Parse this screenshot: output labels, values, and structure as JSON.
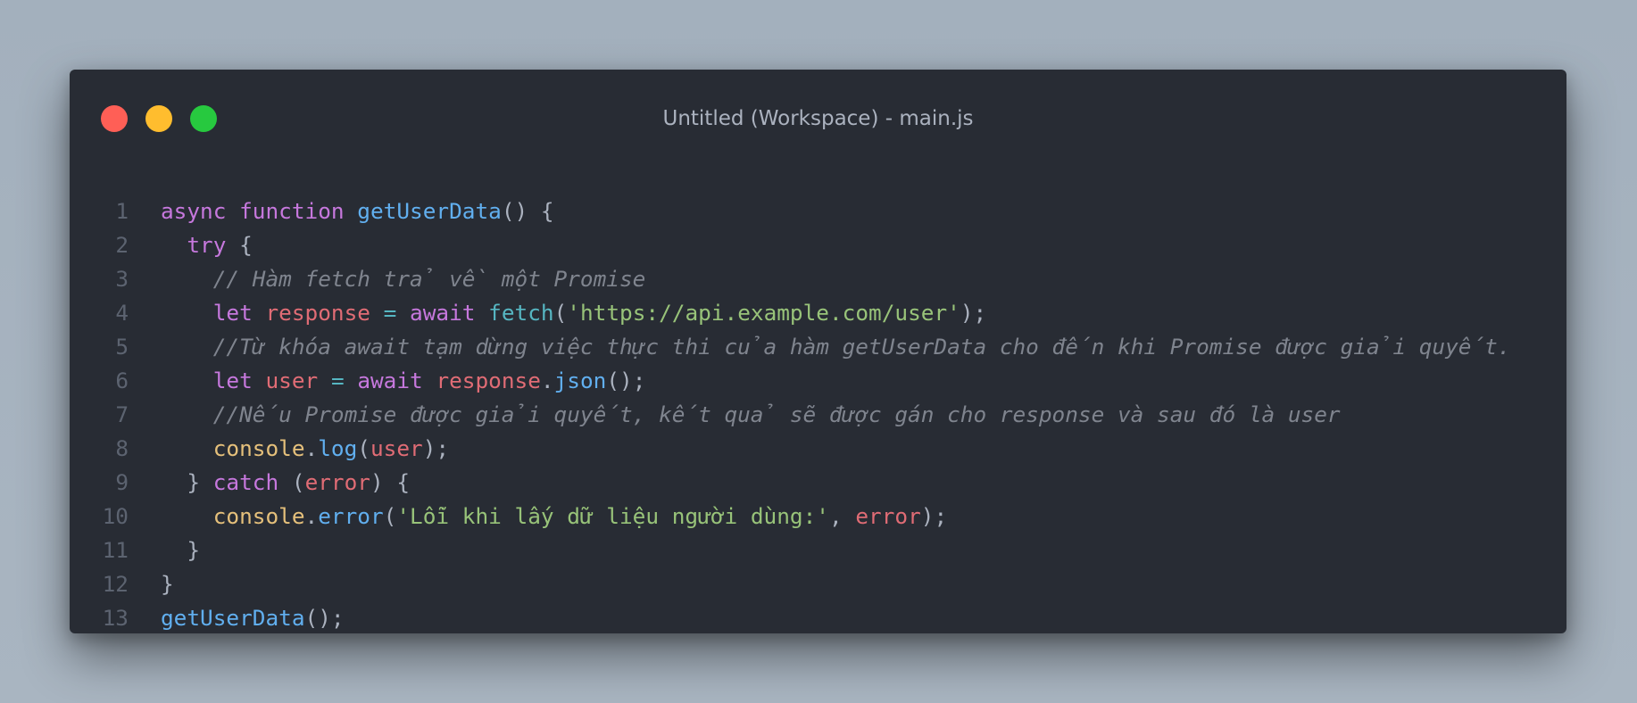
{
  "window": {
    "title": "Untitled (Workspace) - main.js",
    "controls": {
      "close_color": "#ff5f56",
      "minimize_color": "#ffbd2e",
      "maximize_color": "#27c93f"
    }
  },
  "theme": {
    "background": "#282c34",
    "keyword": "#c678dd",
    "function": "#61afef",
    "variable": "#e06c75",
    "string": "#98c379",
    "comment": "#7f848e",
    "object": "#e5c07b"
  },
  "editor": {
    "language": "javascript",
    "line_numbers": [
      "1",
      "2",
      "3",
      "4",
      "5",
      "6",
      "7",
      "8",
      "9",
      "10",
      "11",
      "12",
      "13"
    ],
    "lines": [
      {
        "indent": "",
        "tokens": [
          {
            "t": "kw",
            "v": "async"
          },
          {
            "t": "pn",
            "v": " "
          },
          {
            "t": "kw",
            "v": "function"
          },
          {
            "t": "pn",
            "v": " "
          },
          {
            "t": "fn",
            "v": "getUserData"
          },
          {
            "t": "pn",
            "v": "() {"
          }
        ]
      },
      {
        "indent": "  ",
        "tokens": [
          {
            "t": "kw",
            "v": "try"
          },
          {
            "t": "pn",
            "v": " {"
          }
        ]
      },
      {
        "indent": "    ",
        "tokens": [
          {
            "t": "cm",
            "v": "// Hàm fetch trả về một Promise"
          }
        ]
      },
      {
        "indent": "    ",
        "tokens": [
          {
            "t": "kw",
            "v": "let"
          },
          {
            "t": "pn",
            "v": " "
          },
          {
            "t": "var",
            "v": "response"
          },
          {
            "t": "pn",
            "v": " "
          },
          {
            "t": "op",
            "v": "="
          },
          {
            "t": "pn",
            "v": " "
          },
          {
            "t": "kw",
            "v": "await"
          },
          {
            "t": "pn",
            "v": " "
          },
          {
            "t": "op",
            "v": "fetch"
          },
          {
            "t": "pn",
            "v": "("
          },
          {
            "t": "str",
            "v": "'https://api.example.com/user'"
          },
          {
            "t": "pn",
            "v": ");"
          }
        ]
      },
      {
        "indent": "    ",
        "tokens": [
          {
            "t": "cm",
            "v": "//Từ khóa await tạm dừng việc thực thi của hàm getUserData cho đến khi Promise được giải quyết."
          }
        ]
      },
      {
        "indent": "    ",
        "tokens": [
          {
            "t": "kw",
            "v": "let"
          },
          {
            "t": "pn",
            "v": " "
          },
          {
            "t": "var",
            "v": "user"
          },
          {
            "t": "pn",
            "v": " "
          },
          {
            "t": "op",
            "v": "="
          },
          {
            "t": "pn",
            "v": " "
          },
          {
            "t": "kw",
            "v": "await"
          },
          {
            "t": "pn",
            "v": " "
          },
          {
            "t": "var",
            "v": "response"
          },
          {
            "t": "pn",
            "v": "."
          },
          {
            "t": "fn",
            "v": "json"
          },
          {
            "t": "pn",
            "v": "();"
          }
        ]
      },
      {
        "indent": "    ",
        "tokens": [
          {
            "t": "cm",
            "v": "//Nếu Promise được giải quyết, kết quả sẽ được gán cho response và sau đó là user"
          }
        ]
      },
      {
        "indent": "    ",
        "tokens": [
          {
            "t": "obj",
            "v": "console"
          },
          {
            "t": "pn",
            "v": "."
          },
          {
            "t": "fn",
            "v": "log"
          },
          {
            "t": "pn",
            "v": "("
          },
          {
            "t": "var",
            "v": "user"
          },
          {
            "t": "pn",
            "v": ");"
          }
        ]
      },
      {
        "indent": "  ",
        "tokens": [
          {
            "t": "pn",
            "v": "} "
          },
          {
            "t": "kw",
            "v": "catch"
          },
          {
            "t": "pn",
            "v": " ("
          },
          {
            "t": "var",
            "v": "error"
          },
          {
            "t": "pn",
            "v": ") {"
          }
        ]
      },
      {
        "indent": "    ",
        "tokens": [
          {
            "t": "obj",
            "v": "console"
          },
          {
            "t": "pn",
            "v": "."
          },
          {
            "t": "fn",
            "v": "error"
          },
          {
            "t": "pn",
            "v": "("
          },
          {
            "t": "str",
            "v": "'Lỗi khi lấy dữ liệu người dùng:'"
          },
          {
            "t": "pn",
            "v": ", "
          },
          {
            "t": "var",
            "v": "error"
          },
          {
            "t": "pn",
            "v": ");"
          }
        ]
      },
      {
        "indent": "  ",
        "tokens": [
          {
            "t": "pn",
            "v": "}"
          }
        ]
      },
      {
        "indent": "",
        "tokens": [
          {
            "t": "pn",
            "v": "}"
          }
        ]
      },
      {
        "indent": "",
        "tokens": [
          {
            "t": "fn",
            "v": "getUserData"
          },
          {
            "t": "pn",
            "v": "();"
          }
        ]
      }
    ]
  }
}
